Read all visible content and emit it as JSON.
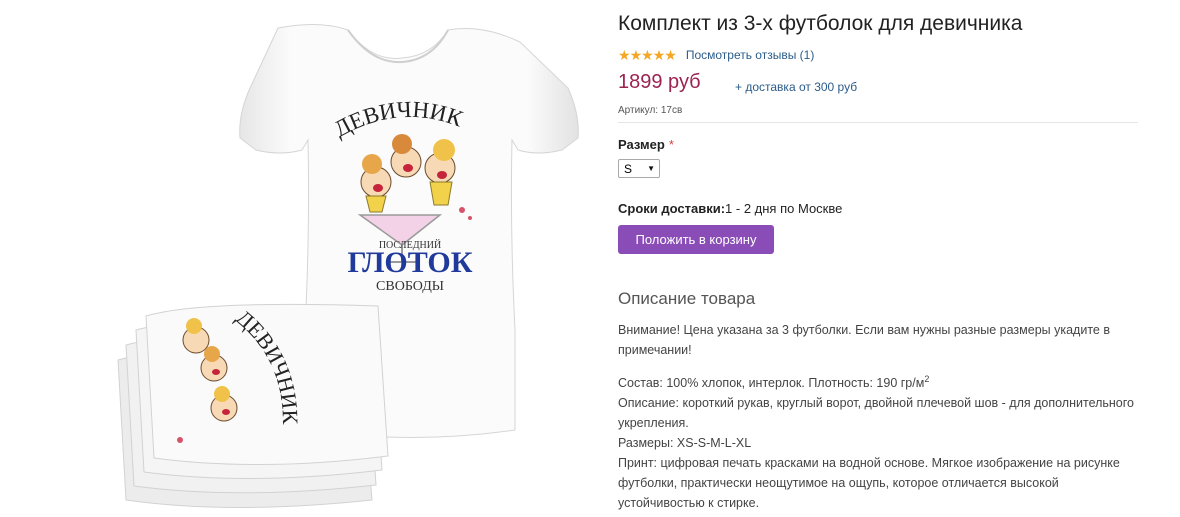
{
  "product": {
    "title": "Комплект из 3-х футболок для девичника",
    "rating": {
      "value": 5,
      "max": 5,
      "reviews_link": "Посмотреть отзывы (1)"
    },
    "price": "1899 руб",
    "delivery_price": "+ доставка от 300 руб",
    "sku": "Артикул: 17св",
    "size": {
      "label": "Размер",
      "required_mark": "*",
      "selected": "S"
    },
    "delivery": {
      "label": "Сроки доставки:",
      "value": "1 - 2 дня по Москве"
    },
    "cart_button": "Положить в корзину",
    "image": {
      "print_title": "ДЕВИЧНИК",
      "print_small_top": "ПОСЛЕДНИЙ",
      "print_big": "ГЛОТОК",
      "print_small_bottom": "СВОБОДЫ",
      "folded_print": "ДЕВИЧНИК"
    }
  },
  "description": {
    "heading": "Описание товара",
    "notice": "Внимание! Цена указана за 3 футболки. Если вам нужны разные размеры укадите в примечании!",
    "composition": "Состав: 100% хлопок, интерлок. Плотность: 190 гр/м",
    "composition_sup": "2",
    "details": "Описание: короткий рукав, круглый ворот, двойной плечевой шов - для дополнительного укрепления.",
    "sizes": "Размеры: XS-S-M-L-XL",
    "print": "Принт: цифровая печать красками на водной основе. Мягкое изображение на рисунке футболки, практически неощутимое на ощупь, которое отличается высокой устойчивостью к стирке."
  },
  "colors": {
    "price": "#9b2352",
    "button": "#8a4db8",
    "link": "#2b5c8a",
    "star": "#f5a623"
  }
}
